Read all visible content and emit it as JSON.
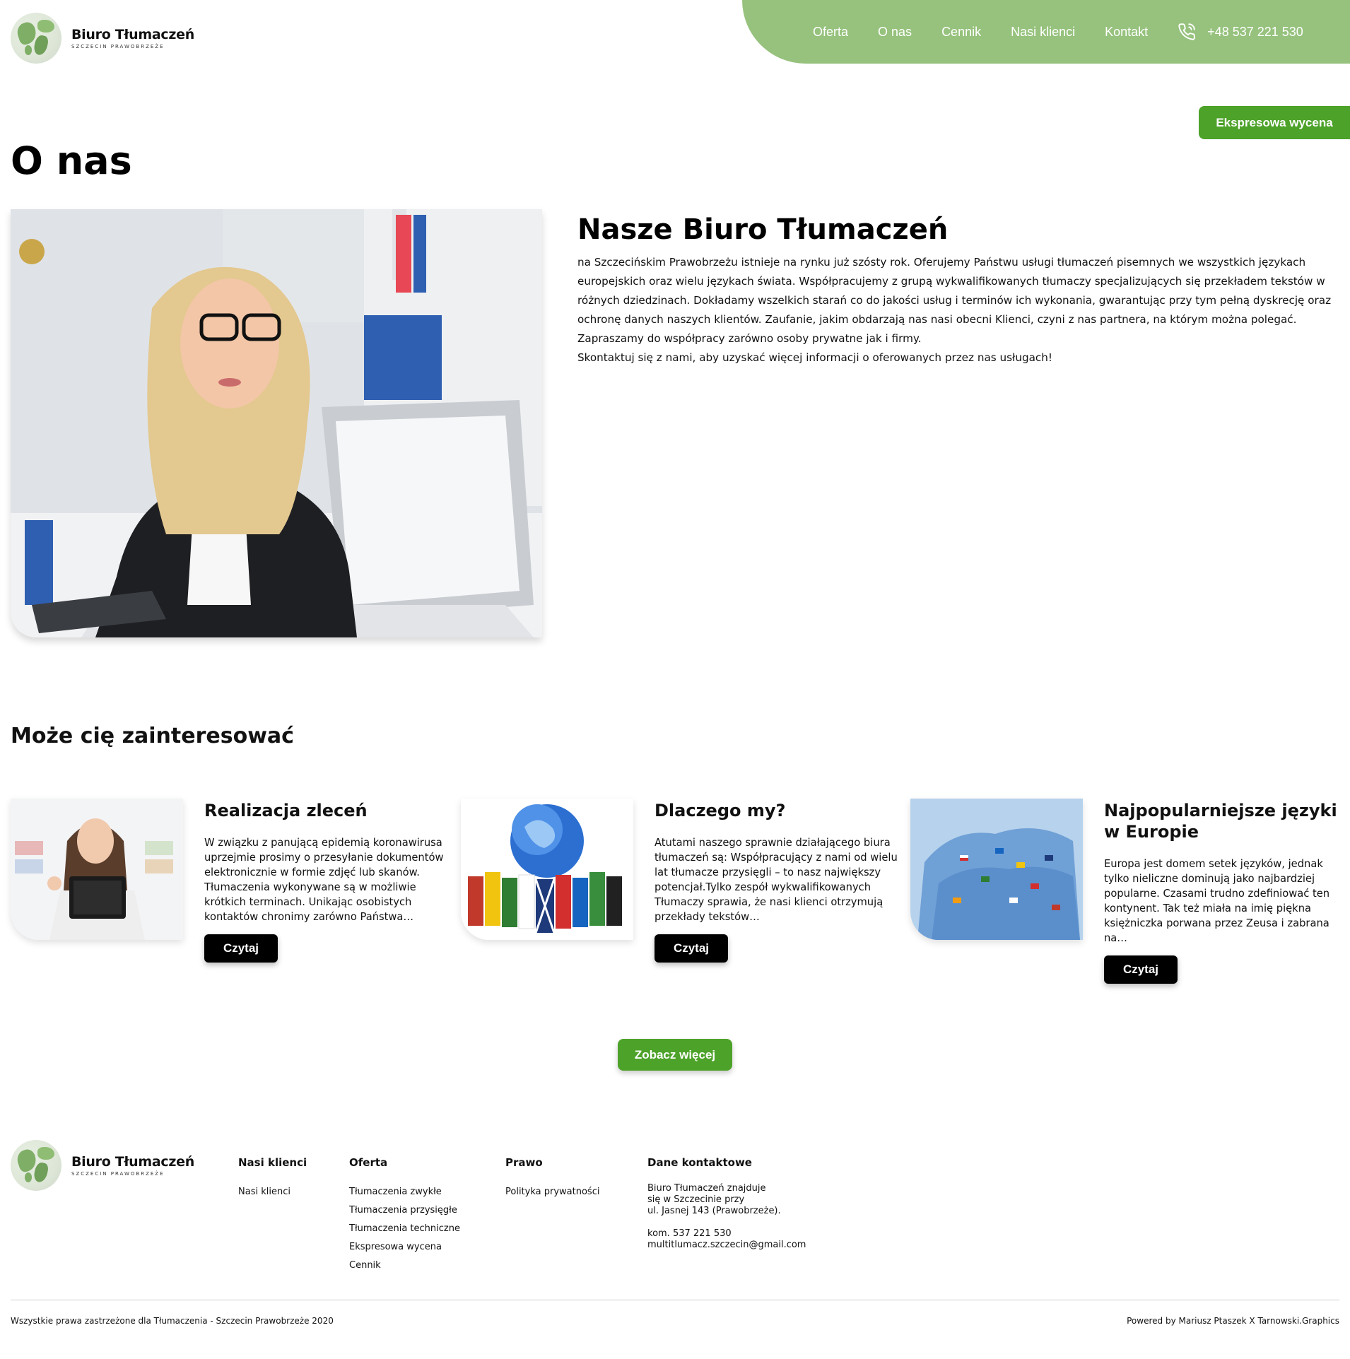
{
  "header": {
    "logo_name": "Biuro Tłumaczeń",
    "logo_sub": "SZCZECIN PRAWOBRZEŻE",
    "nav": [
      "Oferta",
      "O nas",
      "Cennik",
      "Nasi klienci",
      "Kontakt"
    ],
    "phone": "+48 537 221 530",
    "express_label": "Ekspresowa wycena"
  },
  "page": {
    "title": "O nas",
    "about_heading": "Nasze Biuro Tłumaczeń",
    "about_paragraph": "na Szczecińskim Prawobrzeżu istnieje na rynku już szósty rok. Oferujemy Państwu usługi tłumaczeń pisemnych we wszystkich językach europejskich oraz wielu językach świata. Współpracujemy z grupą wykwalifikowanych tłumaczy specjalizujących się przekładem tekstów w różnych dziedzinach. Dokładamy wszelkich starań co do jakości usług i terminów ich wykonania, gwarantując przy tym pełną dyskrecję oraz ochronę danych naszych klientów. Zaufanie, jakim obdarzają nas nasi obecni Klienci, czyni z nas partnera, na którym można polegać. Zapraszamy do współpracy zarówno osoby prywatne jak i firmy.",
    "about_cta": "Skontaktuj się z nami, aby uzyskać więcej informacji o oferowanych przez nas usługach!"
  },
  "related": {
    "heading": "Może cię zainteresować",
    "cards": [
      {
        "title": "Realizacja zleceń",
        "text": "W związku z panującą epidemią koronawirusa uprzejmie prosimy  o przesyłanie dokumentów elektronicznie w formie zdjęć lub skanów. Tłumaczenia wykonywane są w możliwie krótkich terminach. Unikając osobistych kontaktów chronimy zarówno Państwa…",
        "button": "Czytaj"
      },
      {
        "title": "Dlaczego my?",
        "text": "Atutami naszego sprawnie działającego biura tłumaczeń są: Współpracujący z nami od wielu lat tłumacze przysięgli – to nasz największy potencjał.Tylko zespół wykwalifikowanych Tłumaczy sprawia, że nasi klienci otrzymują przekłady tekstów…",
        "button": "Czytaj"
      },
      {
        "title": "Najpopularniejsze języki w Europie",
        "text": "Europa jest domem setek języków, jednak tylko nieliczne dominują jako najbardziej popularne. Czasami trudno zdefiniować  ten kontynent. Tak też miała na imię piękna księżniczka porwana przez Zeusa  i zabrana na…",
        "button": "Czytaj"
      }
    ],
    "more_button": "Zobacz więcej"
  },
  "footer": {
    "logo_name": "Biuro Tłumaczeń",
    "logo_sub": "SZCZECIN PRAWOBRZEŻE",
    "col1": {
      "heading": "Nasi klienci",
      "links": [
        "Nasi klienci"
      ]
    },
    "col2": {
      "heading": "Oferta",
      "links": [
        "Tłumaczenia zwykłe",
        "Tłumaczenia przysięgłe",
        "Tłumaczenia techniczne",
        "Ekspresowa wycena",
        "Cennik"
      ]
    },
    "col3": {
      "heading": "Prawo",
      "links": [
        "Polityka prywatności"
      ]
    },
    "col4": {
      "heading": "Dane kontaktowe",
      "address": [
        "Biuro Tłumaczeń znajduje",
        "się w Szczecinie przy",
        "ul. Jasnej 143 (Prawobrzeże)."
      ],
      "phone": "kom. 537 221 530",
      "email": "multitlumacz.szczecin@gmail.com"
    },
    "copyright": "Wszystkie prawa zastrzeżone dla Tłumaczenia - Szczecin Prawobrzeże 2020",
    "powered": "Powered by Mariusz Ptaszek X Tarnowski.Graphics"
  },
  "colors": {
    "nav_green": "#96c27d",
    "button_green": "#4da229",
    "dark_button": "#000000"
  },
  "icons": [
    "globe-logo-icon",
    "phone-icon"
  ]
}
